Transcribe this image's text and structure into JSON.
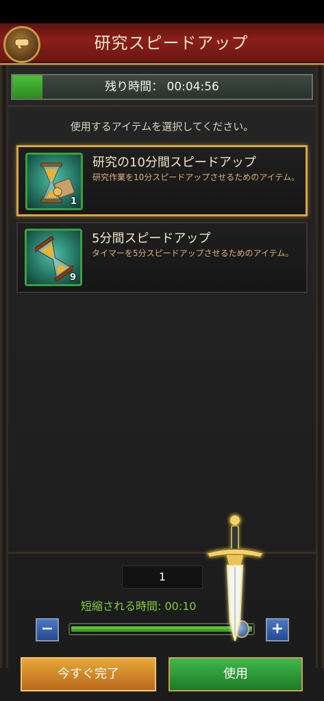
{
  "header": {
    "title": "研究スピードアップ",
    "back_icon": "back-arrow-icon"
  },
  "timer": {
    "label": "残り時間：",
    "value": "00:04:56",
    "progress_percent": 10
  },
  "instruction": "使用するアイテムを選択してください。",
  "items": [
    {
      "name": "研究の10分間スピードアップ",
      "description": "研究作業を10分スピードアップさせるためのアイテム。",
      "count": "1",
      "icon": "hourglass-scroll-icon",
      "selected": true
    },
    {
      "name": "5分間スピードアップ",
      "description": "タイマーを5分スピードアップさせるためのアイテム。",
      "count": "9",
      "icon": "hourglass-icon",
      "selected": false
    }
  ],
  "quantity": {
    "value": "1",
    "slider_fraction": 1.0
  },
  "reduction": {
    "label": "短縮される時間: 00:10"
  },
  "controls": {
    "minus": "−",
    "plus": "+"
  },
  "buttons": {
    "complete_now": "今すぐ完了",
    "use": "使用"
  },
  "colors": {
    "title_bar": "#8a1e18",
    "accent_gold": "#d9a640",
    "progress_green": "#4fbf3a",
    "reduction_text": "#7fcf3a"
  }
}
